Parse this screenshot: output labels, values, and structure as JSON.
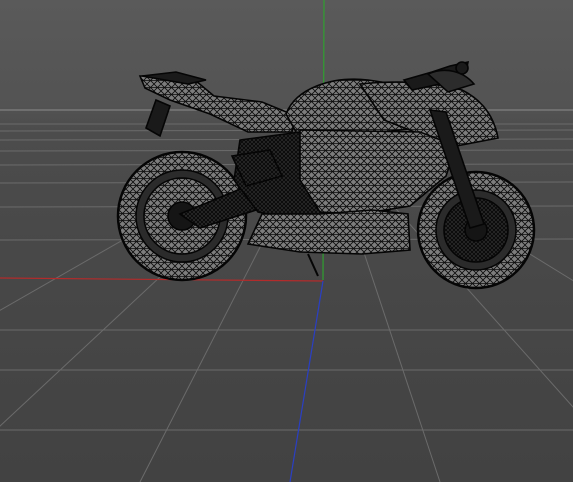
{
  "viewport": {
    "background_color": "#4c4c4c",
    "grid_color": "#6a6a6a",
    "horizon_color": "#8a8a8a",
    "axis_colors": {
      "x": "#b32b2b",
      "y": "#2fa02f",
      "z": "#2a3fc4"
    },
    "model": {
      "type": "motorcycle",
      "display_mode": "wireframe",
      "wire_color": "#0a0a0a"
    }
  }
}
